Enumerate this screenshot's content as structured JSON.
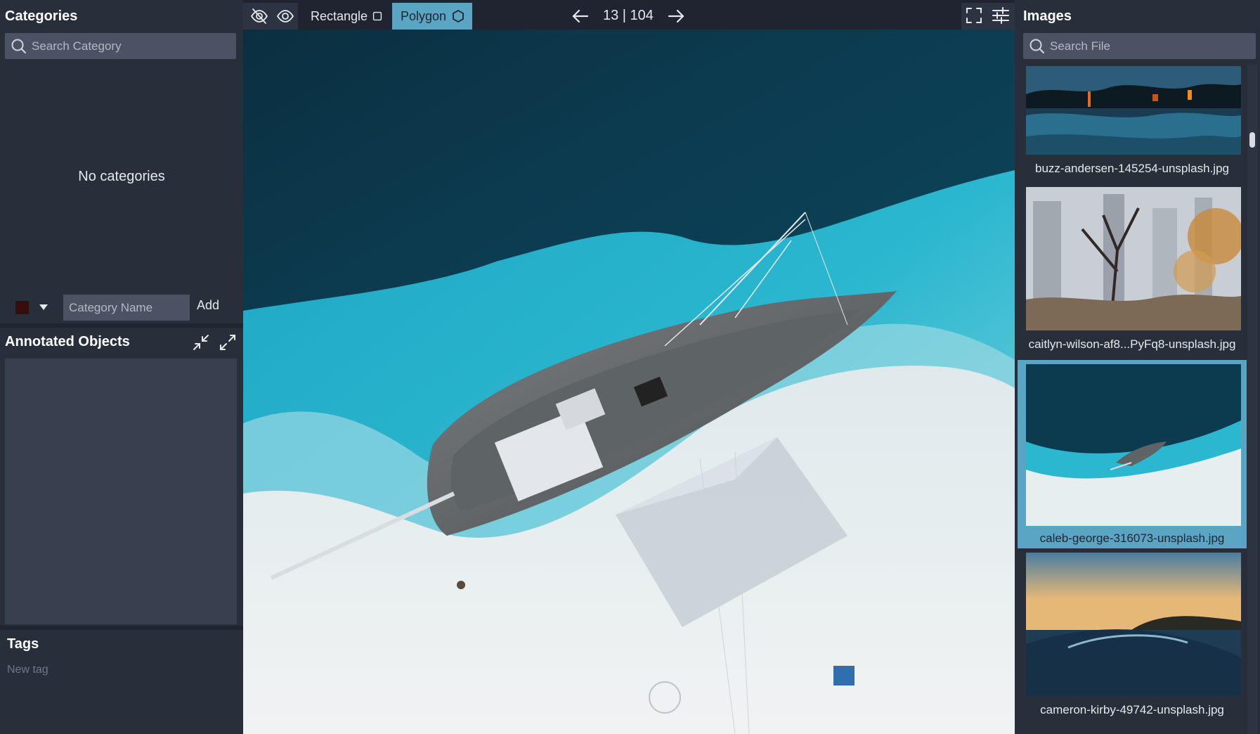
{
  "categories_panel": {
    "title": "Categories",
    "search_placeholder": "Search Category",
    "empty_message": "No categories",
    "category_name_placeholder": "Category Name",
    "add_label": "Add",
    "swatch_color": "#3a0d0d"
  },
  "objects_panel": {
    "title": "Annotated Objects"
  },
  "tags_panel": {
    "title": "Tags",
    "input_placeholder": "New tag"
  },
  "toolbar": {
    "rectangle_label": "Rectangle",
    "polygon_label": "Polygon",
    "active_tool": "Polygon",
    "page_count": "13 | 104"
  },
  "images_panel": {
    "title": "Images",
    "search_placeholder": "Search File",
    "files": [
      {
        "name": "buzz-andersen-145254-unsplash.jpg",
        "selected": false
      },
      {
        "name": "caitlyn-wilson-af8...PyFq8-unsplash.jpg",
        "selected": false
      },
      {
        "name": "caleb-george-316073-unsplash.jpg",
        "selected": true
      },
      {
        "name": "cameron-kirby-49742-unsplash.jpg",
        "selected": false
      }
    ]
  },
  "colors": {
    "accent": "#5aa5c3",
    "panel_bg": "#282e3a",
    "input_bg": "#4b5263"
  }
}
